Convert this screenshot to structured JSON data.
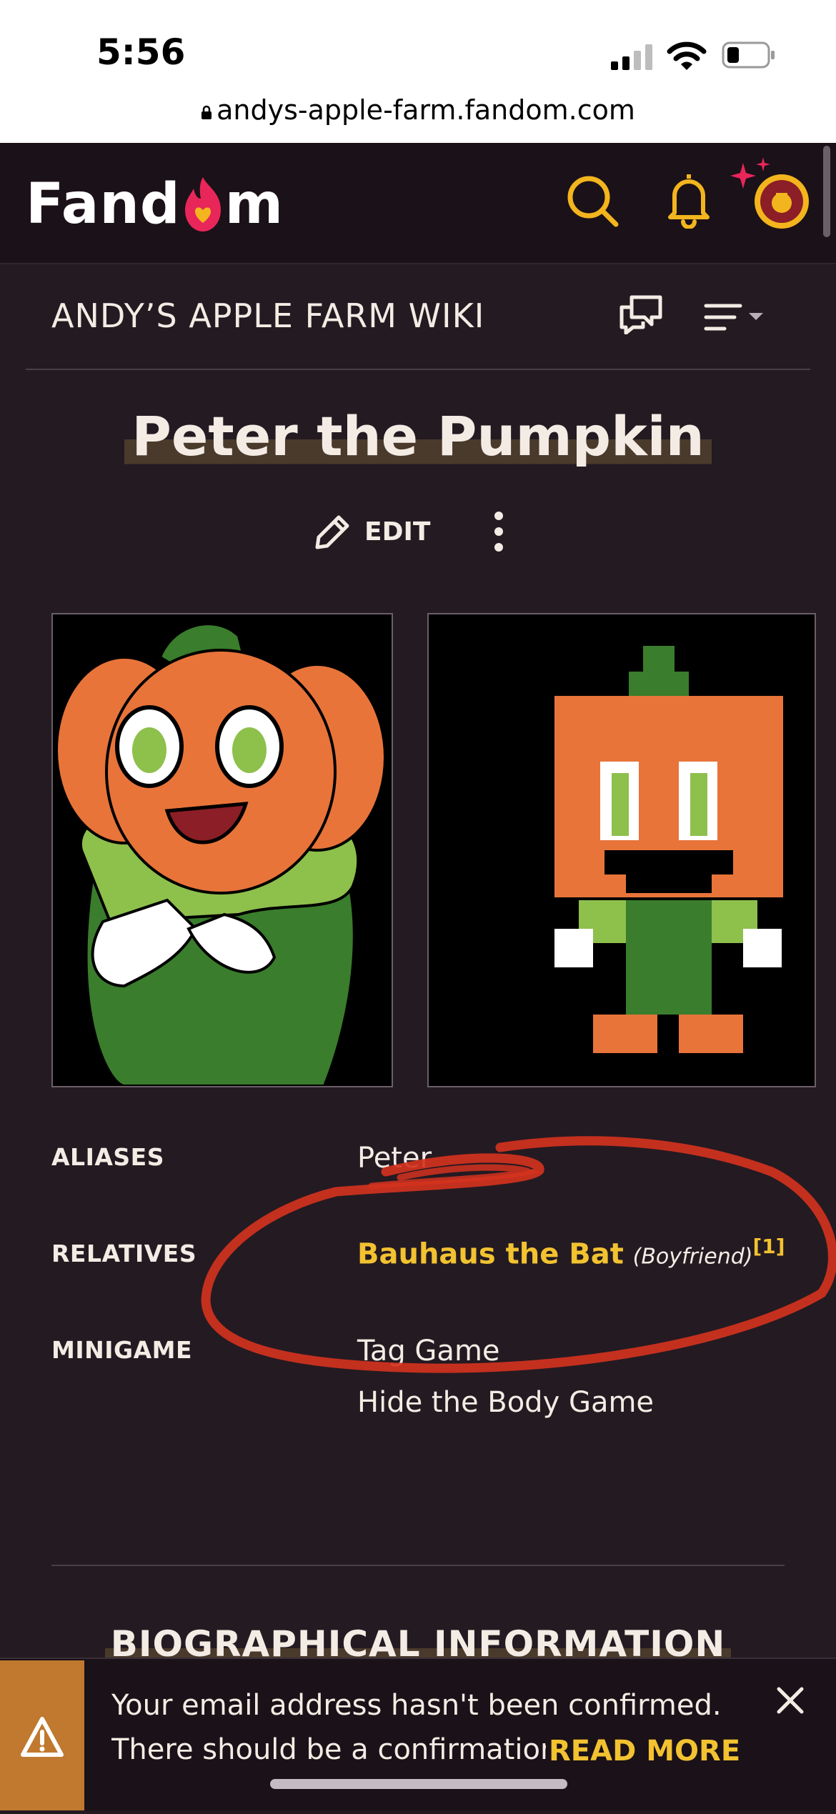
{
  "status_bar": {
    "time": "5:56",
    "url": "andys-apple-farm.fandom.com"
  },
  "fandom_header": {
    "logo": "Fandom",
    "logo_parts": [
      "Fand",
      "m"
    ]
  },
  "wiki_header": {
    "title": "ANDY’S APPLE FARM WIKI"
  },
  "article": {
    "title": "Peter the Pumpkin",
    "edit_label": "EDIT",
    "infobox": {
      "aliases_label": "ALIASES",
      "aliases_value": "Peter",
      "relatives_label": "RELATIVES",
      "relatives_link": "Bauhaus the Bat",
      "relatives_note": "(Boyfriend)",
      "relatives_ref": "[1]",
      "minigame_label": "MINIGAME",
      "minigame_values": [
        "Tag Game",
        "Hide the Body Game"
      ]
    },
    "section_heading": "BIOGRAPHICAL INFORMATION"
  },
  "banner": {
    "line1": "Your email address hasn't been confirmed.",
    "line2": "There should be a confirmation",
    "read_more": "READ MORE"
  },
  "colors": {
    "accent": "#f2c230",
    "header_bg": "#1b1118",
    "page_bg": "#241a22",
    "annotation": "#d3321e",
    "warning": "#c0792f"
  },
  "icons": [
    "lock-icon",
    "search-icon",
    "bell-icon",
    "sparkle-icon",
    "avatar",
    "discussion-icon",
    "menu-icon",
    "pencil-icon",
    "more-icon",
    "warning-icon",
    "close-icon"
  ]
}
